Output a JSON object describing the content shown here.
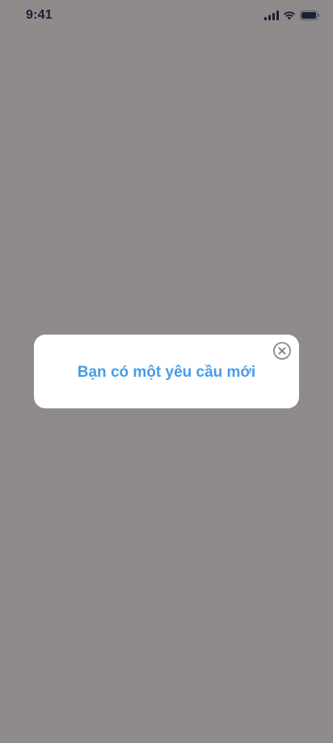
{
  "status_bar": {
    "time": "9:41",
    "icons": [
      "signal-icon",
      "wifi-icon",
      "battery-icon"
    ]
  },
  "modal": {
    "message": "Bạn có một yêu cầu mới",
    "close_icon": "close-icon"
  },
  "colors": {
    "overlay": "#8f8b8b",
    "modal_background": "#ffffff",
    "message_text": "#4a9ce8",
    "close_icon": "#8a8a8a",
    "status_text": "#1a1f36"
  }
}
